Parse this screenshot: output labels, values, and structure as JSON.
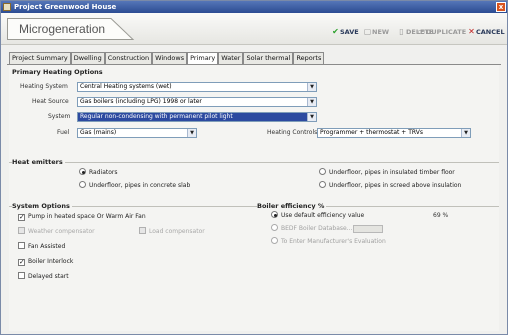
{
  "window": {
    "title": "Project Greenwood House",
    "close_glyph": "x"
  },
  "header": {
    "section": "Microgeneration",
    "toolbar": {
      "save": "SAVE",
      "new": "NEW",
      "delete": "DELETE",
      "duplicate": "DUPLICATE",
      "cancel": "CANCEL"
    }
  },
  "tabs": [
    "Project Summary",
    "Dwelling",
    "Construction",
    "Windows",
    "Primary",
    "Water",
    "Solar thermal",
    "Reports"
  ],
  "active_tab": "Primary",
  "primary_heating": {
    "title": "Primary Heating Options",
    "heating_system": {
      "label": "Heating System",
      "value": "Central Heating systems (wet)"
    },
    "heat_source": {
      "label": "Heat Source",
      "value": "Gas boilers (including LPG) 1998 or later"
    },
    "system": {
      "label": "System",
      "value": "Regular non-condensing with permanent pilot light"
    },
    "fuel": {
      "label": "Fuel",
      "value": "Gas (mains)"
    },
    "heating_controls": {
      "label": "Heating Controls",
      "value": "Programmer + thermostat + TRVs"
    }
  },
  "heat_emitters": {
    "title": "Heat emitters",
    "options": [
      {
        "label": "Radiators",
        "selected": true
      },
      {
        "label": "Underfloor, pipes in insulated timber floor",
        "selected": false
      },
      {
        "label": "Underfloor, pipes in concrete slab",
        "selected": false
      },
      {
        "label": "Underfloor, pipes in screed above insulation",
        "selected": false
      }
    ]
  },
  "system_options": {
    "title": "System Options",
    "pump": {
      "label": "Pump in heated space Or Warm Air Fan",
      "checked": true
    },
    "weather_comp": {
      "label": "Weather compensator",
      "checked": false,
      "disabled": true
    },
    "load_comp": {
      "label": "Load compensator",
      "checked": false,
      "disabled": true
    },
    "fan_assisted": {
      "label": "Fan Assisted",
      "checked": false
    },
    "boiler_interlock": {
      "label": "Boiler Interlock",
      "checked": true
    },
    "delayed_start": {
      "label": "Delayed start",
      "checked": false
    }
  },
  "boiler_efficiency": {
    "title": "Boiler efficiency %",
    "default": {
      "label": "Use default efficiency value",
      "value": "69 %"
    },
    "sap_db": {
      "label": "BEDF Boiler Database..."
    },
    "manual": {
      "label": "To Enter Manufacturer's Evaluation"
    }
  },
  "colors": {
    "titlebar": "#2c4c92",
    "selection": "#2c4aa0",
    "save_icon": "#2aa02a",
    "cancel_icon": "#c02020"
  }
}
